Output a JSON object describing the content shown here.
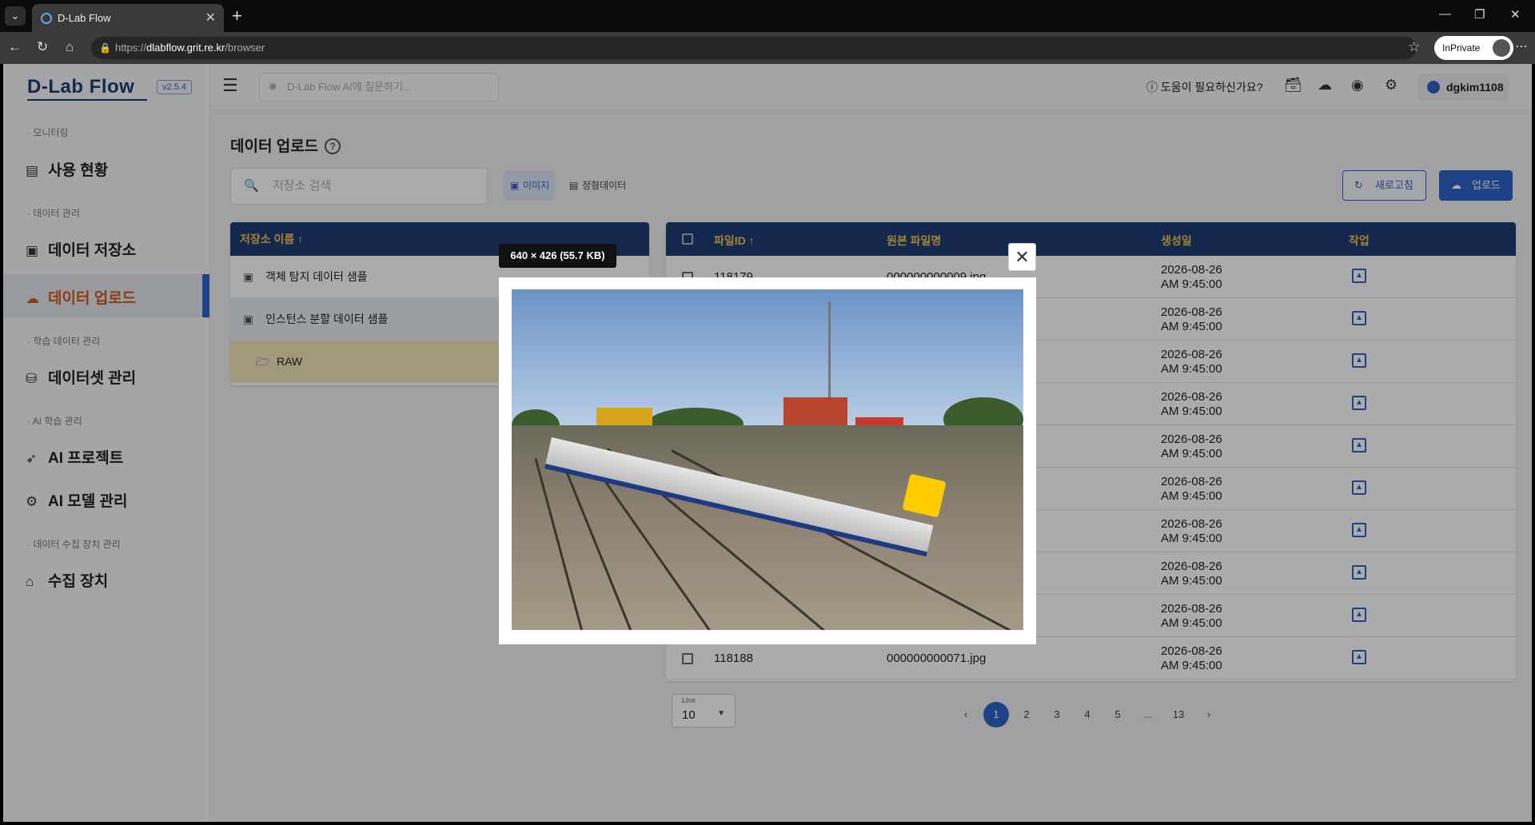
{
  "browser": {
    "tab_title": "D-Lab Flow",
    "url_prefix": "https://",
    "url_domain": "dlabflow.grit.re.kr",
    "url_path": "/browser",
    "inprivate": "InPrivate"
  },
  "app": {
    "logo": "D-Lab Flow",
    "version": "v2.5.4",
    "ai_placeholder": "D-Lab Flow AI에 질문하기...",
    "help": "도움이 필요하신가요?",
    "username": "dgkim1108"
  },
  "sidebar": {
    "sec_monitoring": "모니터링",
    "item_usage": "사용 현황",
    "sec_data": "데이터 관리",
    "item_storage": "데이터 저장소",
    "item_upload": "데이터 업로드",
    "sec_train_data": "학습 데이터 관리",
    "item_dataset": "데이터셋 관리",
    "sec_ai": "AI 학습 관리",
    "item_project": "AI 프로젝트",
    "item_model": "AI 모델 관리",
    "sec_device": "데이터 수집 장치 관리",
    "item_device": "수집 장치"
  },
  "page": {
    "title": "데이터 업로드",
    "store_search_placeholder": "저장소 검색",
    "chip_image": "이미지",
    "chip_structured": "정형데이터",
    "refresh": "새로고침",
    "upload": "업로드"
  },
  "stores": {
    "header": "저장소 이름 ↑",
    "items": [
      "객체 탐지 데이터 샘플",
      "인스턴스 분할 데이터 샘플",
      "RAW"
    ]
  },
  "files": {
    "headers": {
      "id": "파일ID ↑",
      "name": "원본 파일명",
      "created": "생성일",
      "action": "작업"
    },
    "rows": [
      {
        "id": "118179",
        "name": "000000000009.jpg",
        "date": "2026-08-26",
        "time": "AM 9:45:00"
      },
      {
        "id": "",
        "name": "",
        "date": "2026-08-26",
        "time": "AM 9:45:00"
      },
      {
        "id": "",
        "name": "",
        "date": "2026-08-26",
        "time": "AM 9:45:00"
      },
      {
        "id": "",
        "name": "",
        "date": "2026-08-26",
        "time": "AM 9:45:00"
      },
      {
        "id": "",
        "name": "",
        "date": "2026-08-26",
        "time": "AM 9:45:00"
      },
      {
        "id": "",
        "name": "",
        "date": "2026-08-26",
        "time": "AM 9:45:00"
      },
      {
        "id": "",
        "name": "",
        "date": "2026-08-26",
        "time": "AM 9:45:00"
      },
      {
        "id": "",
        "name": "",
        "date": "2026-08-26",
        "time": "AM 9:45:00"
      },
      {
        "id": "",
        "name": "",
        "date": "2026-08-26",
        "time": "AM 9:45:00"
      },
      {
        "id": "118188",
        "name": "000000000071.jpg",
        "date": "2026-08-26",
        "time": "AM 9:45:00"
      }
    ]
  },
  "pagination": {
    "line_label": "Line",
    "line_value": "10",
    "pages": [
      "1",
      "2",
      "3",
      "4",
      "5",
      "...",
      "13"
    ],
    "prev": "‹",
    "next": "›"
  },
  "preview": {
    "dimensions": "640 × 426 (55.7 KB)"
  }
}
